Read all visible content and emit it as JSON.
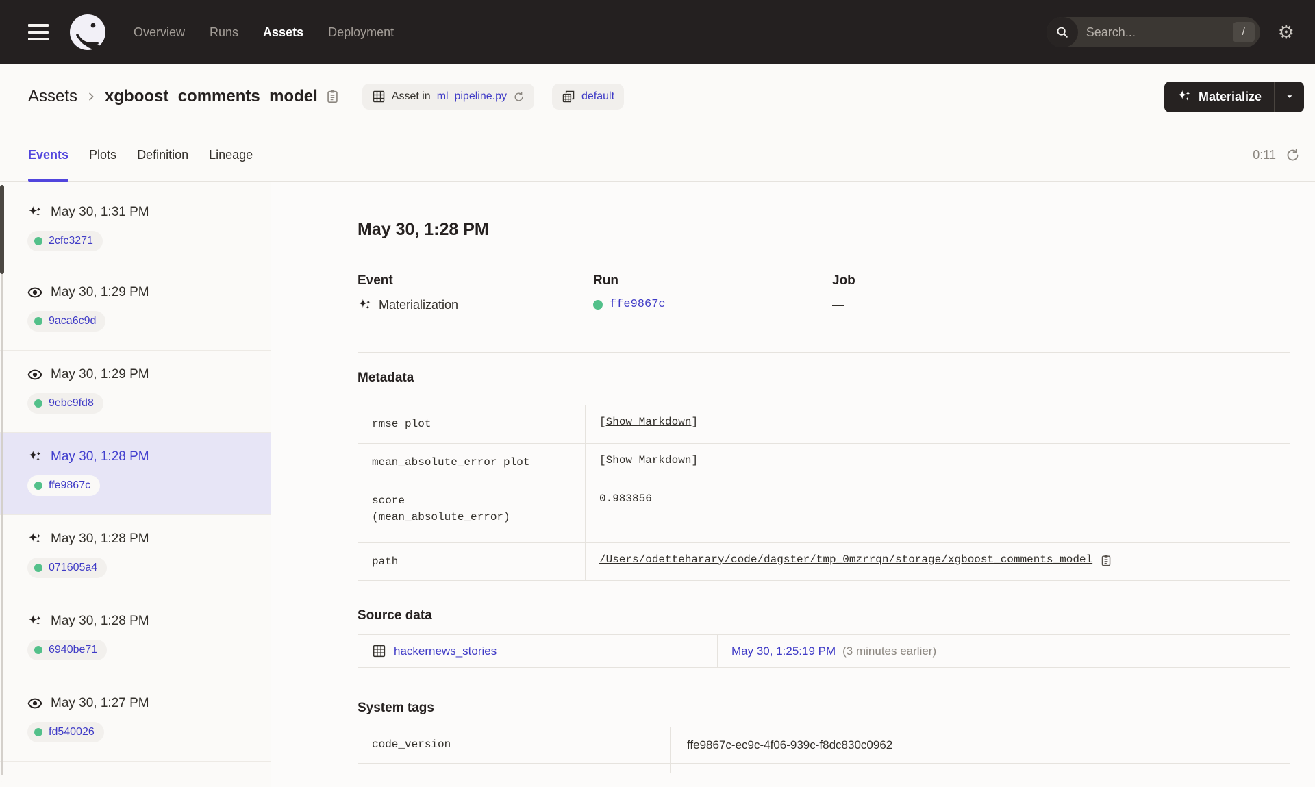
{
  "header": {
    "nav": [
      {
        "label": "Overview",
        "active": false
      },
      {
        "label": "Runs",
        "active": false
      },
      {
        "label": "Assets",
        "active": true
      },
      {
        "label": "Deployment",
        "active": false
      }
    ],
    "search": {
      "placeholder": "Search...",
      "shortcut": "/"
    }
  },
  "icons": {
    "gear": "⚙"
  },
  "breadcrumb": {
    "root": "Assets",
    "asset_name": "xgboost_comments_model"
  },
  "badges": {
    "asset_in_prefix": "Asset in",
    "asset_in_file": "ml_pipeline.py",
    "group": "default"
  },
  "actions": {
    "materialize": "Materialize"
  },
  "tabs": [
    {
      "label": "Events",
      "active": true
    },
    {
      "label": "Plots",
      "active": false
    },
    {
      "label": "Definition",
      "active": false
    },
    {
      "label": "Lineage",
      "active": false
    }
  ],
  "refresh": {
    "countdown": "0:11"
  },
  "events": [
    {
      "type": "materialization",
      "time": "May 30, 1:31 PM",
      "run_id": "2cfc3271",
      "selected": false
    },
    {
      "type": "observation",
      "time": "May 30, 1:29 PM",
      "run_id": "9aca6c9d",
      "selected": false
    },
    {
      "type": "observation",
      "time": "May 30, 1:29 PM",
      "run_id": "9ebc9fd8",
      "selected": false
    },
    {
      "type": "materialization",
      "time": "May 30, 1:28 PM",
      "run_id": "ffe9867c",
      "selected": true
    },
    {
      "type": "materialization",
      "time": "May 30, 1:28 PM",
      "run_id": "071605a4",
      "selected": false
    },
    {
      "type": "materialization",
      "time": "May 30, 1:28 PM",
      "run_id": "6940be71",
      "selected": false
    },
    {
      "type": "observation",
      "time": "May 30, 1:27 PM",
      "run_id": "fd540026",
      "selected": false
    }
  ],
  "detail": {
    "heading": "May 30, 1:28 PM",
    "event_label": "Event",
    "event_value": "Materialization",
    "run_label": "Run",
    "run_value": "ffe9867c",
    "job_label": "Job",
    "job_value": "—",
    "metadata_title": "Metadata",
    "metadata": {
      "rows": [
        {
          "key": "rmse plot",
          "kind": "markdown"
        },
        {
          "key": "mean_absolute_error plot",
          "kind": "markdown"
        },
        {
          "key": "score (mean_absolute_error)",
          "value": "0.983856",
          "kind": "text"
        },
        {
          "key": "path",
          "value": "/Users/odetteharary/code/dagster/tmp_0mzrrqn/storage/xgboost_comments_model",
          "kind": "path"
        }
      ],
      "markdown_link": "Show Markdown",
      "bracket_open": "[",
      "bracket_close": "]"
    },
    "source_title": "Source data",
    "source": {
      "asset": "hackernews_stories",
      "time": "May 30, 1:25:19 PM",
      "relative": "(3 minutes earlier)"
    },
    "tags_title": "System tags",
    "tags": [
      {
        "key": "code_version",
        "value": "ffe9867c-ec9c-4f06-939c-f8dc830c0962"
      }
    ]
  },
  "colors": {
    "header_bg": "#242020",
    "accent_indigo": "#4340ce",
    "success_green": "#53c08a",
    "selected_row_bg": "#e7e5f6"
  }
}
